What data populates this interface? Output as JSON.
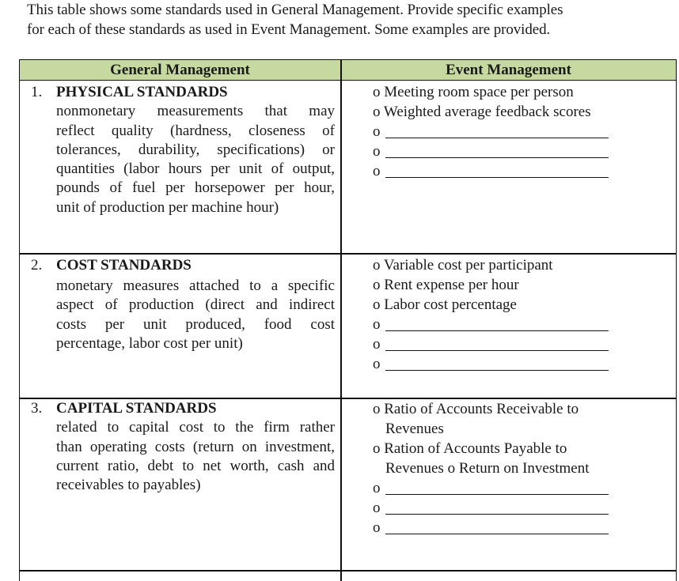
{
  "intro": {
    "line1": "This table shows some standards used in General Management. Provide specific examples",
    "line2": "for each of these standards as used in Event Management. Some examples are provided."
  },
  "table": {
    "headers": {
      "left": "General Management",
      "right": "Event Management"
    },
    "header_color": "#c6d9a0",
    "bullet": "o",
    "rows": [
      {
        "number": "1.",
        "title": "PHYSICAL STANDARDS",
        "description_lines": [
          "nonmonetary measurements that may",
          "reflect quality (hardness, closeness of",
          "tolerances, durability, specifications) or",
          "quantities (labor hours per unit of output,",
          "pounds of fuel per horsepower per hour,",
          "unit of production per machine hour)"
        ],
        "examples": [
          "o Meeting room space per person",
          "o Weighted average feedback scores"
        ],
        "blank_count": 3
      },
      {
        "number": "2.",
        "title": "COST STANDARDS",
        "description_lines": [
          "monetary measures attached to a specific",
          "aspect of production (direct and indirect",
          "costs per unit produced, food cost",
          "percentage, labor cost per unit)"
        ],
        "examples": [
          "o Variable cost per participant",
          "o Rent expense per hour",
          "o Labor cost percentage"
        ],
        "blank_count": 3
      },
      {
        "number": "3.",
        "title": "CAPITAL STANDARDS",
        "description_lines": [
          "related to capital cost to the firm rather",
          "than operating costs (return on investment,",
          "current ratio, debt to net worth, cash and",
          "receivables to payables)"
        ],
        "examples": [
          "o Ratio of Accounts Receivable to Revenues",
          "o Ration of Accounts Payable to Revenues o Return on Investment"
        ],
        "blank_count": 3
      }
    ]
  }
}
